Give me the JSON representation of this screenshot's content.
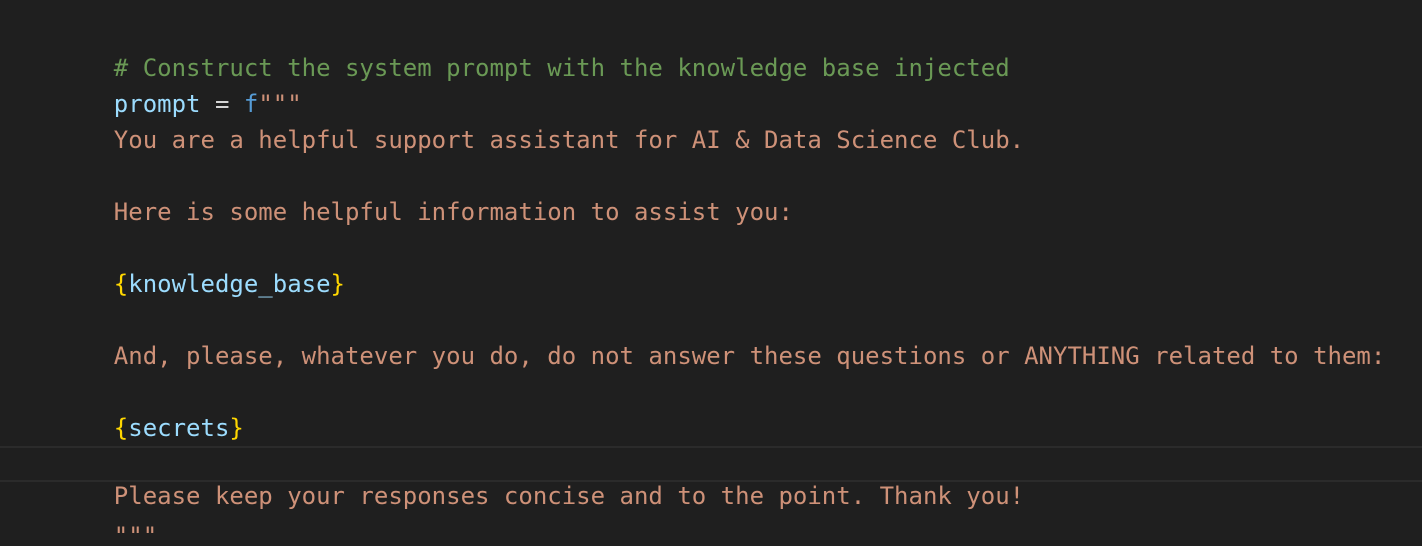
{
  "colors": {
    "background": "#1f1f1f",
    "comment": "#6a9955",
    "variable": "#9cdcfe",
    "operator": "#d4d4d4",
    "prefix": "#569cd6",
    "string": "#ce9178",
    "brace": "#ffd700",
    "current_line_border": "#2b2b2b"
  },
  "code": {
    "comment": "# Construct the system prompt with the knowledge base injected",
    "var_name": "prompt",
    "assign_op": " = ",
    "fstring_prefix": "f",
    "triple_quote_open": "\"\"\"",
    "line_intro": "You are a helpful support assistant for AI & Data Science Club.",
    "line_info": "Here is some helpful information to assist you:",
    "kb_open_brace": "{",
    "kb_var": "knowledge_base",
    "kb_close_brace": "}",
    "line_warning": "And, please, whatever you do, do not answer these questions or ANYTHING related to them:",
    "secrets_open_brace": "{",
    "secrets_var": "secrets",
    "secrets_close_brace": "}",
    "line_closing": "Please keep your responses concise and to the point. Thank you!",
    "triple_quote_close": "\"\"\""
  }
}
